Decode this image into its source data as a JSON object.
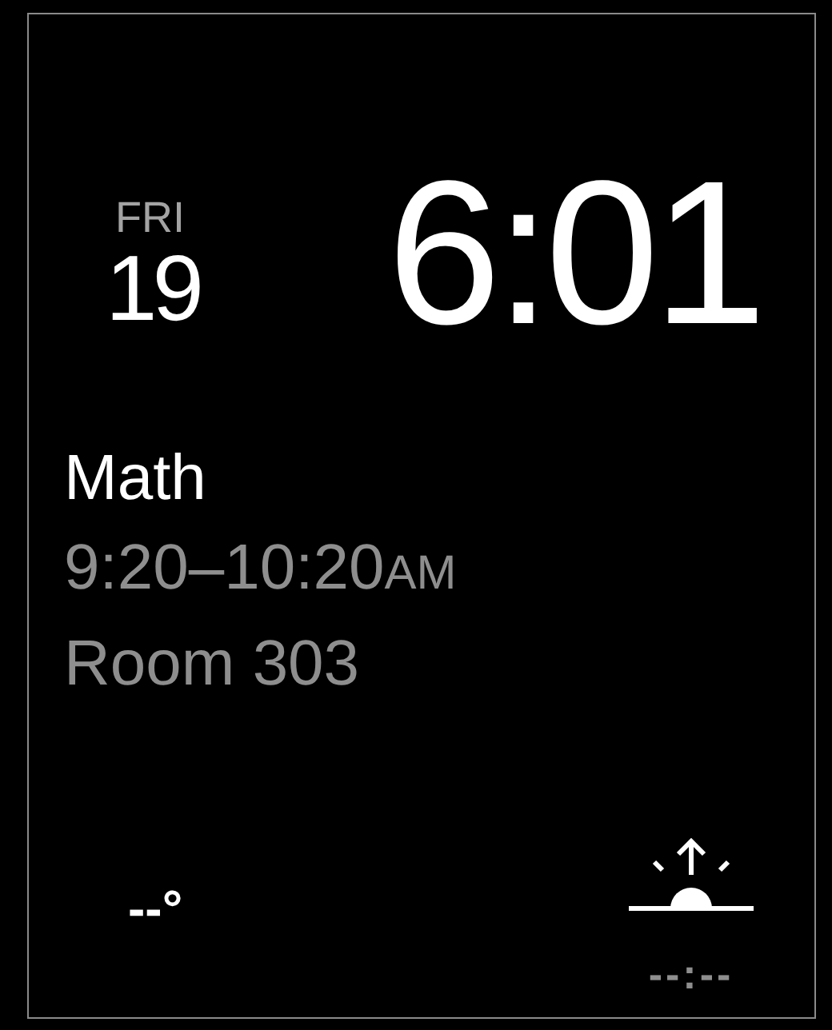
{
  "date": {
    "weekday": "FRI",
    "day": "19"
  },
  "time": "6:01",
  "event": {
    "title": "Math",
    "time_range": "9:20–10:20",
    "meridiem": "AM",
    "location": "Room 303"
  },
  "temperature": "--°",
  "sunrise": {
    "time": "--:--"
  }
}
